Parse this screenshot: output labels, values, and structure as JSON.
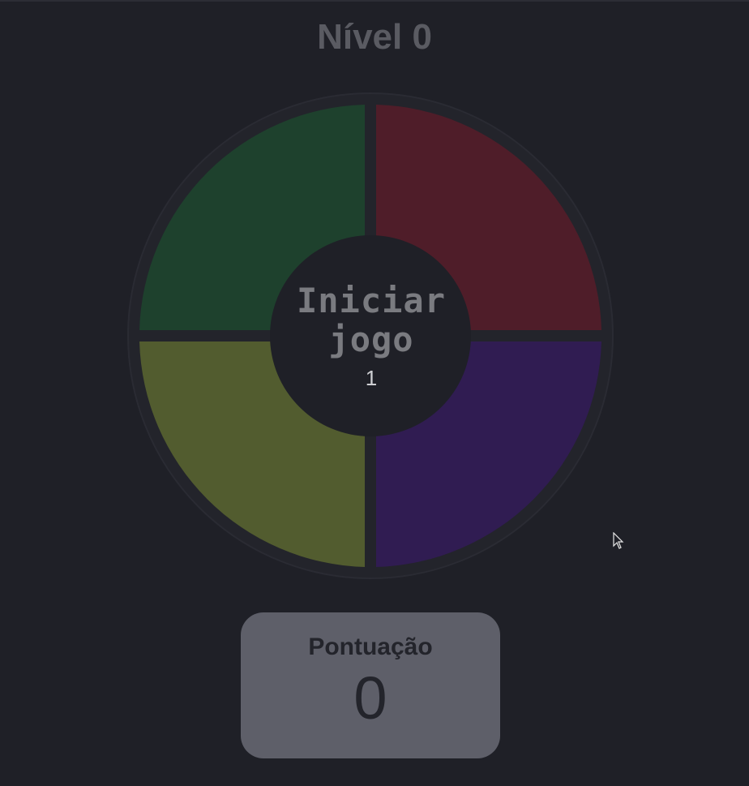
{
  "header": {
    "level_title": "Nível 0"
  },
  "board": {
    "start_button": {
      "line1": "Iniciar",
      "line2": "jogo",
      "count": "1"
    },
    "pads": [
      {
        "id": "green",
        "color": "#1e412d"
      },
      {
        "id": "red",
        "color": "#4f1d29"
      },
      {
        "id": "yellow",
        "color": "#525c2f"
      },
      {
        "id": "purple",
        "color": "#301c52"
      }
    ],
    "background_color": "#1f2027"
  },
  "score": {
    "label": "Pontuação",
    "value": "0"
  },
  "colors": {
    "page_background": "#1f2027",
    "score_box": "#5e5f69",
    "title_text": "#5a5b62"
  }
}
